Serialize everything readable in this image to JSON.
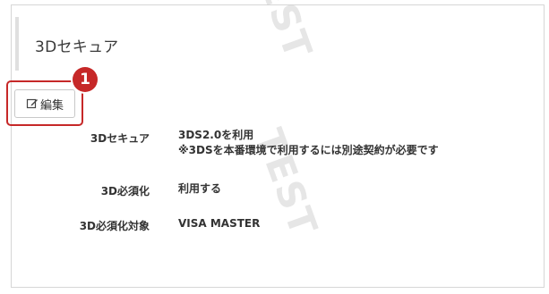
{
  "section": {
    "title": "3Dセキュア"
  },
  "toolbar": {
    "edit_label": "編集"
  },
  "callout": {
    "number": "1"
  },
  "fields": [
    {
      "label": "3Dセキュア",
      "value_line1": "3DS2.0を利用",
      "value_line2": "※3DSを本番環境で利用するには別途契約が必要です"
    },
    {
      "label": "3D必須化",
      "value_line1": "利用する"
    },
    {
      "label": "3D必須化対象",
      "value_line1": "VISA MASTER"
    }
  ],
  "watermark": {
    "text": "TEST"
  },
  "colors": {
    "accent": "#c62828",
    "border": "#d6d6d6"
  }
}
